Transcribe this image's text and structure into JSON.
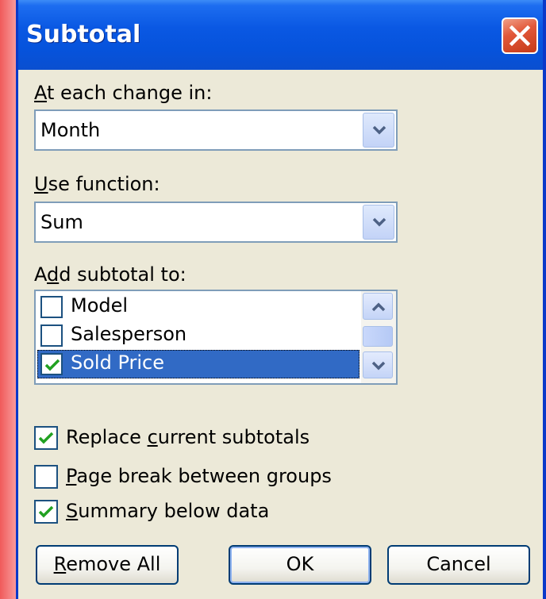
{
  "dialog": {
    "title": "Subtotal"
  },
  "change_in": {
    "label_prefix": "",
    "label_accel": "A",
    "label_rest": "t each change in:",
    "value": "Month"
  },
  "use_function": {
    "label_accel": "U",
    "label_rest": "se function:",
    "value": "Sum"
  },
  "add_subtotal": {
    "label_prefix": "A",
    "label_accel": "d",
    "label_rest": "d subtotal to:",
    "items": [
      {
        "label": "Model",
        "checked": false,
        "selected": false
      },
      {
        "label": "Salesperson",
        "checked": false,
        "selected": false
      },
      {
        "label": "Sold Price",
        "checked": true,
        "selected": true
      }
    ]
  },
  "options": {
    "replace": {
      "pre": "Replace ",
      "accel": "c",
      "post": "urrent subtotals",
      "checked": true
    },
    "page_break": {
      "pre": "",
      "accel": "P",
      "post": "age break between groups",
      "checked": false
    },
    "summary": {
      "pre": "",
      "accel": "S",
      "post": "ummary below data",
      "checked": true
    }
  },
  "buttons": {
    "remove_all": {
      "accel": "R",
      "rest": "emove All"
    },
    "ok": "OK",
    "cancel": "Cancel"
  },
  "colors": {
    "titlebar": "#0653dc",
    "dialog_bg": "#ece9d8",
    "selection": "#316ac5",
    "check": "#21a121",
    "close": "#e2583a"
  }
}
